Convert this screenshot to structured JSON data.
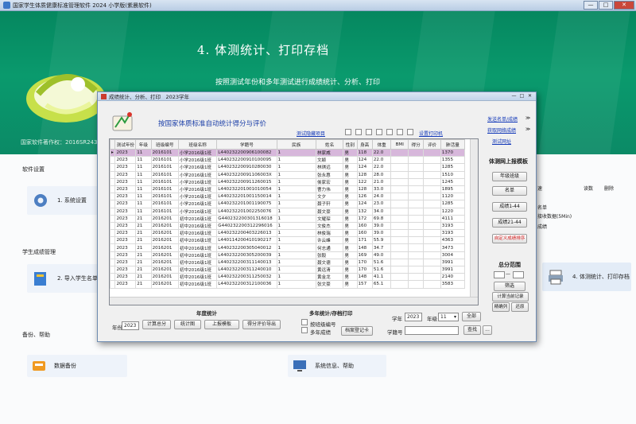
{
  "main_window": {
    "title": "国家学生体质健康标准管理软件 2024 小学版(紫晨软件)",
    "minimize": "—",
    "maximize": "□",
    "close": "✕"
  },
  "banner": {
    "heading": "4. 体测统计、打印存档",
    "subheading": "按照测试年份和多年测试进行成绩统计、分析、打印",
    "registration": "国家软件著作权：2016SR243460"
  },
  "sections": {
    "software_settings": "软件设置",
    "system_settings": "1. 系统设置",
    "student_grades": "学生成绩管理",
    "import_students": "2. 导入学生名单",
    "backup_help": "备份、帮助",
    "data_backup": "数据备份",
    "system_info": "系统信息、帮助",
    "print_stats": "4. 体测统计、打印存档"
  },
  "background_panel": {
    "col_a": "速",
    "col_b": "读数",
    "col_c": "删除",
    "line_a": "名单",
    "line_b": "接收数据(5Min)",
    "line_c": "成绩"
  },
  "dialog": {
    "title": "成绩统计、分析、打印　2023学年",
    "heading": "按国家体质标准自动统计得分与评价",
    "hide_items_link": "测试隐藏项目",
    "print_settings_link": "设置打印机",
    "send_list_link": "发送名单/成绩",
    "get_grades_link": "获取网络成绩",
    "test_web_link": "测试网址",
    "arrow_a": "≫",
    "arrow_b": "≫",
    "minimize": "—",
    "maximize": "□",
    "close": "✕"
  },
  "table": {
    "columns": [
      "测试年份",
      "年级",
      "班级编号",
      "班级名称",
      "学籍号",
      "民族",
      "姓名",
      "性别",
      "身高",
      "体重",
      "BMI",
      "得分",
      "评价",
      "肺活量"
    ],
    "rows": [
      [
        "2023",
        "11",
        "2016101",
        "小学2016级1班",
        "L440232200906100082",
        "1",
        "林家威",
        "男",
        "118",
        "22.0",
        "",
        "",
        "",
        "1370"
      ],
      [
        "2023",
        "11",
        "2016101",
        "小学2016级1班",
        "L440232200910100095",
        "1",
        "文颖",
        "男",
        "124",
        "22.0",
        "",
        "",
        "",
        "1355"
      ],
      [
        "2023",
        "11",
        "2016101",
        "小学2016级1班",
        "L440232200910280030",
        "1",
        "林琪远",
        "男",
        "124",
        "22.0",
        "",
        "",
        "",
        "1285"
      ],
      [
        "2023",
        "11",
        "2016101",
        "小学2016级1班",
        "L44023220091106003X",
        "1",
        "张永惠",
        "男",
        "128",
        "28.0",
        "",
        "",
        "",
        "1510"
      ],
      [
        "2023",
        "11",
        "2016101",
        "小学2016级1班",
        "L440232200911260015",
        "1",
        "俟家宏",
        "男",
        "122",
        "21.0",
        "",
        "",
        "",
        "1245"
      ],
      [
        "2023",
        "11",
        "2016101",
        "小学2016级1班",
        "L440232201001010054",
        "1",
        "曹力伟",
        "男",
        "128",
        "33.0",
        "",
        "",
        "",
        "1895"
      ],
      [
        "2023",
        "11",
        "2016101",
        "小学2016级1班",
        "L440232201001150014",
        "1",
        "文夕",
        "男",
        "126",
        "24.0",
        "",
        "",
        "",
        "1120"
      ],
      [
        "2023",
        "11",
        "2016101",
        "小学2016级1班",
        "L440232201001190075",
        "1",
        "聂子轩",
        "男",
        "124",
        "23.0",
        "",
        "",
        "",
        "1285"
      ],
      [
        "2023",
        "11",
        "2016101",
        "小学2016级1班",
        "L440232201002250076",
        "1",
        "聂文豪",
        "男",
        "132",
        "34.0",
        "",
        "",
        "",
        "1220"
      ],
      [
        "2023",
        "21",
        "2016201",
        "初中2016级1班",
        "G440232200301316018",
        "1",
        "文耀琛",
        "男",
        "172",
        "69.8",
        "",
        "",
        "",
        "4111"
      ],
      [
        "2023",
        "21",
        "2016201",
        "初中2016级1班",
        "G440232200312296016",
        "1",
        "文俊杰",
        "男",
        "160",
        "39.0",
        "",
        "",
        "",
        "3193"
      ],
      [
        "2023",
        "21",
        "2016201",
        "初中2016级1班",
        "L440232200403226013",
        "1",
        "林俊瑞",
        "男",
        "160",
        "39.0",
        "",
        "",
        "",
        "3193"
      ],
      [
        "2023",
        "21",
        "2016201",
        "初中2016级1班",
        "L440114200410190217",
        "1",
        "许云峰",
        "男",
        "171",
        "55.9",
        "",
        "",
        "",
        "4363"
      ],
      [
        "2023",
        "21",
        "2016201",
        "初中2016级1班",
        "L440232200305040012",
        "1",
        "何志通",
        "男",
        "148",
        "34.7",
        "",
        "",
        "",
        "3473"
      ],
      [
        "2023",
        "21",
        "2016201",
        "初中2016级1班",
        "L440232200305200039",
        "1",
        "张毅",
        "男",
        "169",
        "49.0",
        "",
        "",
        "",
        "3004"
      ],
      [
        "2023",
        "21",
        "2016201",
        "初中2016级1班",
        "L440232200311140013",
        "1",
        "聂文德",
        "男",
        "170",
        "51.6",
        "",
        "",
        "",
        "3991"
      ],
      [
        "2023",
        "21",
        "2016201",
        "初中2016级1班",
        "L440232200311240010",
        "1",
        "黄远清",
        "男",
        "170",
        "51.6",
        "",
        "",
        "",
        "3991"
      ],
      [
        "2023",
        "21",
        "2016201",
        "初中2016级1班",
        "L440232200311250032",
        "1",
        "黄金龙",
        "男",
        "148",
        "41.1",
        "",
        "",
        "",
        "2140"
      ],
      [
        "2023",
        "21",
        "2016201",
        "初中2016级1班",
        "L440232200312100036",
        "1",
        "张文豪",
        "男",
        "157",
        "65.1",
        "",
        "",
        "",
        "3583"
      ]
    ]
  },
  "right_panel": {
    "title": "体测网上报模板",
    "btn_grade_class": "年级班级",
    "btn_list": "名单",
    "btn_grades_144": "成绩1-44",
    "btn_grades_2144": "成绩21-44",
    "btn_custom": "自定义成绩排序",
    "score_range": "总分范围",
    "dash": "—",
    "btn_filter": "筛选",
    "btn_calc_current": "计算当前记录",
    "btn_precise": "精确列",
    "btn_restore": "还原"
  },
  "annual_stats": {
    "title": "年度统计",
    "year_label": "年份",
    "year_value": "2023",
    "btn_calc_total": "计算总分",
    "btn_chart": "统计图",
    "btn_report_template": "上报模板",
    "btn_export": "得分评价导出"
  },
  "multi_year": {
    "title": "多年统计/存档打印",
    "by_class": "按班级编号",
    "multi_grades": "多年成绩",
    "btn_archive": "档案登记卡",
    "school_year_label": "学年",
    "school_year_value": "2023",
    "grade_label": "年级",
    "grade_value": "11",
    "btn_all": "全部",
    "student_id_label": "学籍号",
    "student_id_value": "",
    "btn_search": "查找",
    "btn_more": "..."
  }
}
